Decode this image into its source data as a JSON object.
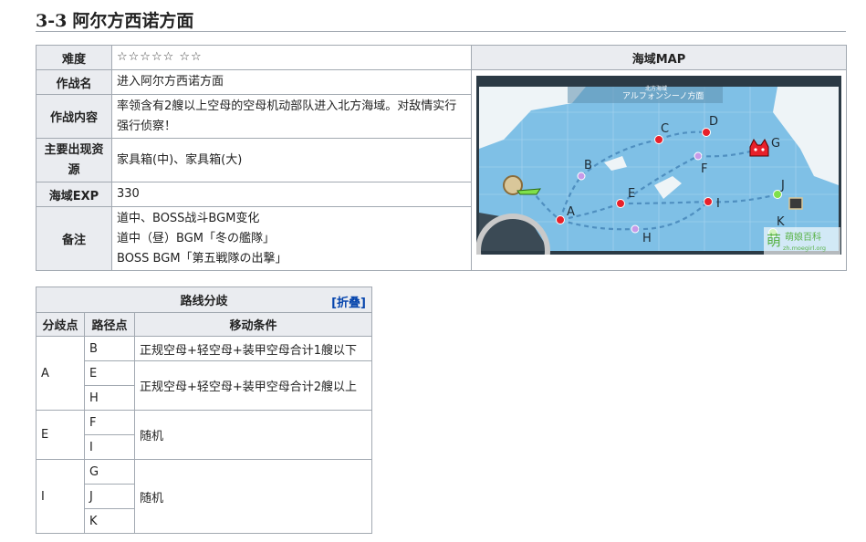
{
  "heading": {
    "number": "3-3",
    "title": "阿尔方西诺方面"
  },
  "info": {
    "difficulty_label": "难度",
    "difficulty_value": "☆☆☆☆☆ ☆☆",
    "op_name_label": "作战名",
    "op_name_value": "进入阿尔方西诺方面",
    "op_content_label": "作战内容",
    "op_content_value": "率领含有2艘以上空母的空母机动部队进入北方海域。对敌情实行强行侦察！",
    "resource_label_1": "主要出现资",
    "resource_label_2": "源",
    "resource_value": "家具箱(中)、家具箱(大)",
    "exp_label": "海域EXP",
    "exp_value": "330",
    "notes_label": "备注",
    "notes_lines": [
      "道中、BOSS战斗BGM变化",
      "道中（昼）BGM「冬の艦隊」",
      "BOSS BGM「第五戦隊の出撃」"
    ],
    "map_header": "海域MAP"
  },
  "map": {
    "area_title": "アルフォンシーノ方面",
    "area_subtitle": "北方海域",
    "watermark_main": "萌娘百科",
    "watermark_url": "zh.moegirl.org",
    "watermark_mark": "萌",
    "nodes": [
      "A",
      "B",
      "C",
      "D",
      "E",
      "F",
      "G",
      "H",
      "I",
      "J",
      "K"
    ]
  },
  "routes": {
    "title": "路线分歧",
    "collapse_label": "[折叠]",
    "col_branch": "分歧点",
    "col_path": "路径点",
    "col_condition": "移动条件",
    "groups": [
      {
        "point": "A",
        "paths": [
          "B",
          "E",
          "H"
        ],
        "conditions": [
          "正规空母+轻空母+装甲空母合计1艘以下",
          "正规空母+轻空母+装甲空母合计2艘以上"
        ]
      },
      {
        "point": "E",
        "paths": [
          "F",
          "I"
        ],
        "conditions": [
          "随机"
        ]
      },
      {
        "point": "I",
        "paths": [
          "G",
          "J",
          "K"
        ],
        "conditions": [
          "随机"
        ]
      }
    ]
  },
  "colors": {
    "sea": "#7fc0e6",
    "node_red": "#e8202a",
    "node_purple": "#c79ae8",
    "node_green": "#7fe04a"
  }
}
